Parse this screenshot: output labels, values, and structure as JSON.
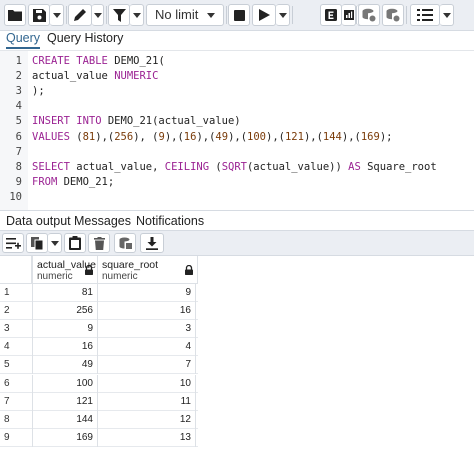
{
  "toolbar": {
    "limit_label": "No limit",
    "buttons": [
      "folder-open",
      "save",
      "edit",
      "filter",
      "stop",
      "execute",
      "explain",
      "explain-analyze",
      "commit",
      "rollback",
      "macros"
    ]
  },
  "query_tabs": [
    "Query",
    "Query History"
  ],
  "editor": {
    "line_numbers": [
      "1",
      "2",
      "3",
      "4",
      "5",
      "6",
      "7",
      "8",
      "9",
      "10"
    ],
    "lines": [
      [
        [
          "kw",
          "CREATE TABLE "
        ],
        [
          "plain",
          "DEMO_21("
        ]
      ],
      [
        [
          "plain",
          "actual_value "
        ],
        [
          "kw",
          "NUMERIC"
        ]
      ],
      [
        [
          "plain",
          ");"
        ]
      ],
      [],
      [
        [
          "kw",
          "INSERT INTO "
        ],
        [
          "plain",
          "DEMO_21(actual_value)"
        ]
      ],
      [
        [
          "kw",
          "VALUES "
        ],
        [
          "plain",
          "("
        ],
        [
          "num",
          "81"
        ],
        [
          "plain",
          "),("
        ],
        [
          "num",
          "256"
        ],
        [
          "plain",
          "), ("
        ],
        [
          "num",
          "9"
        ],
        [
          "plain",
          "),("
        ],
        [
          "num",
          "16"
        ],
        [
          "plain",
          "),("
        ],
        [
          "num",
          "49"
        ],
        [
          "plain",
          "),("
        ],
        [
          "num",
          "100"
        ],
        [
          "plain",
          "),("
        ],
        [
          "num",
          "121"
        ],
        [
          "plain",
          "),("
        ],
        [
          "num",
          "144"
        ],
        [
          "plain",
          "),("
        ],
        [
          "num",
          "169"
        ],
        [
          "plain",
          ");"
        ]
      ],
      [],
      [
        [
          "kw",
          "SELECT "
        ],
        [
          "plain",
          "actual_value, "
        ],
        [
          "fn",
          "CEILING "
        ],
        [
          "plain",
          "("
        ],
        [
          "fn",
          "SQRT"
        ],
        [
          "plain",
          "(actual_value)) "
        ],
        [
          "kw",
          "AS "
        ],
        [
          "plain",
          "Square_root"
        ]
      ],
      [
        [
          "kw",
          "FROM "
        ],
        [
          "plain",
          "DEMO_21;"
        ]
      ],
      []
    ]
  },
  "output_tabs": [
    "Data output",
    "Messages",
    "Notifications"
  ],
  "grid": {
    "columns": [
      {
        "name": "actual_value",
        "type": "numeric"
      },
      {
        "name": "square_root",
        "type": "numeric"
      }
    ],
    "rows": [
      {
        "n": "1",
        "a": "81",
        "b": "9"
      },
      {
        "n": "2",
        "a": "256",
        "b": "16"
      },
      {
        "n": "3",
        "a": "9",
        "b": "3"
      },
      {
        "n": "4",
        "a": "16",
        "b": "4"
      },
      {
        "n": "5",
        "a": "49",
        "b": "7"
      },
      {
        "n": "6",
        "a": "100",
        "b": "10"
      },
      {
        "n": "7",
        "a": "121",
        "b": "11"
      },
      {
        "n": "8",
        "a": "144",
        "b": "12"
      },
      {
        "n": "9",
        "a": "169",
        "b": "13"
      }
    ]
  },
  "colors": {
    "accent": "#326690",
    "keyword": "#9b2393",
    "number": "#7b3c0a"
  }
}
